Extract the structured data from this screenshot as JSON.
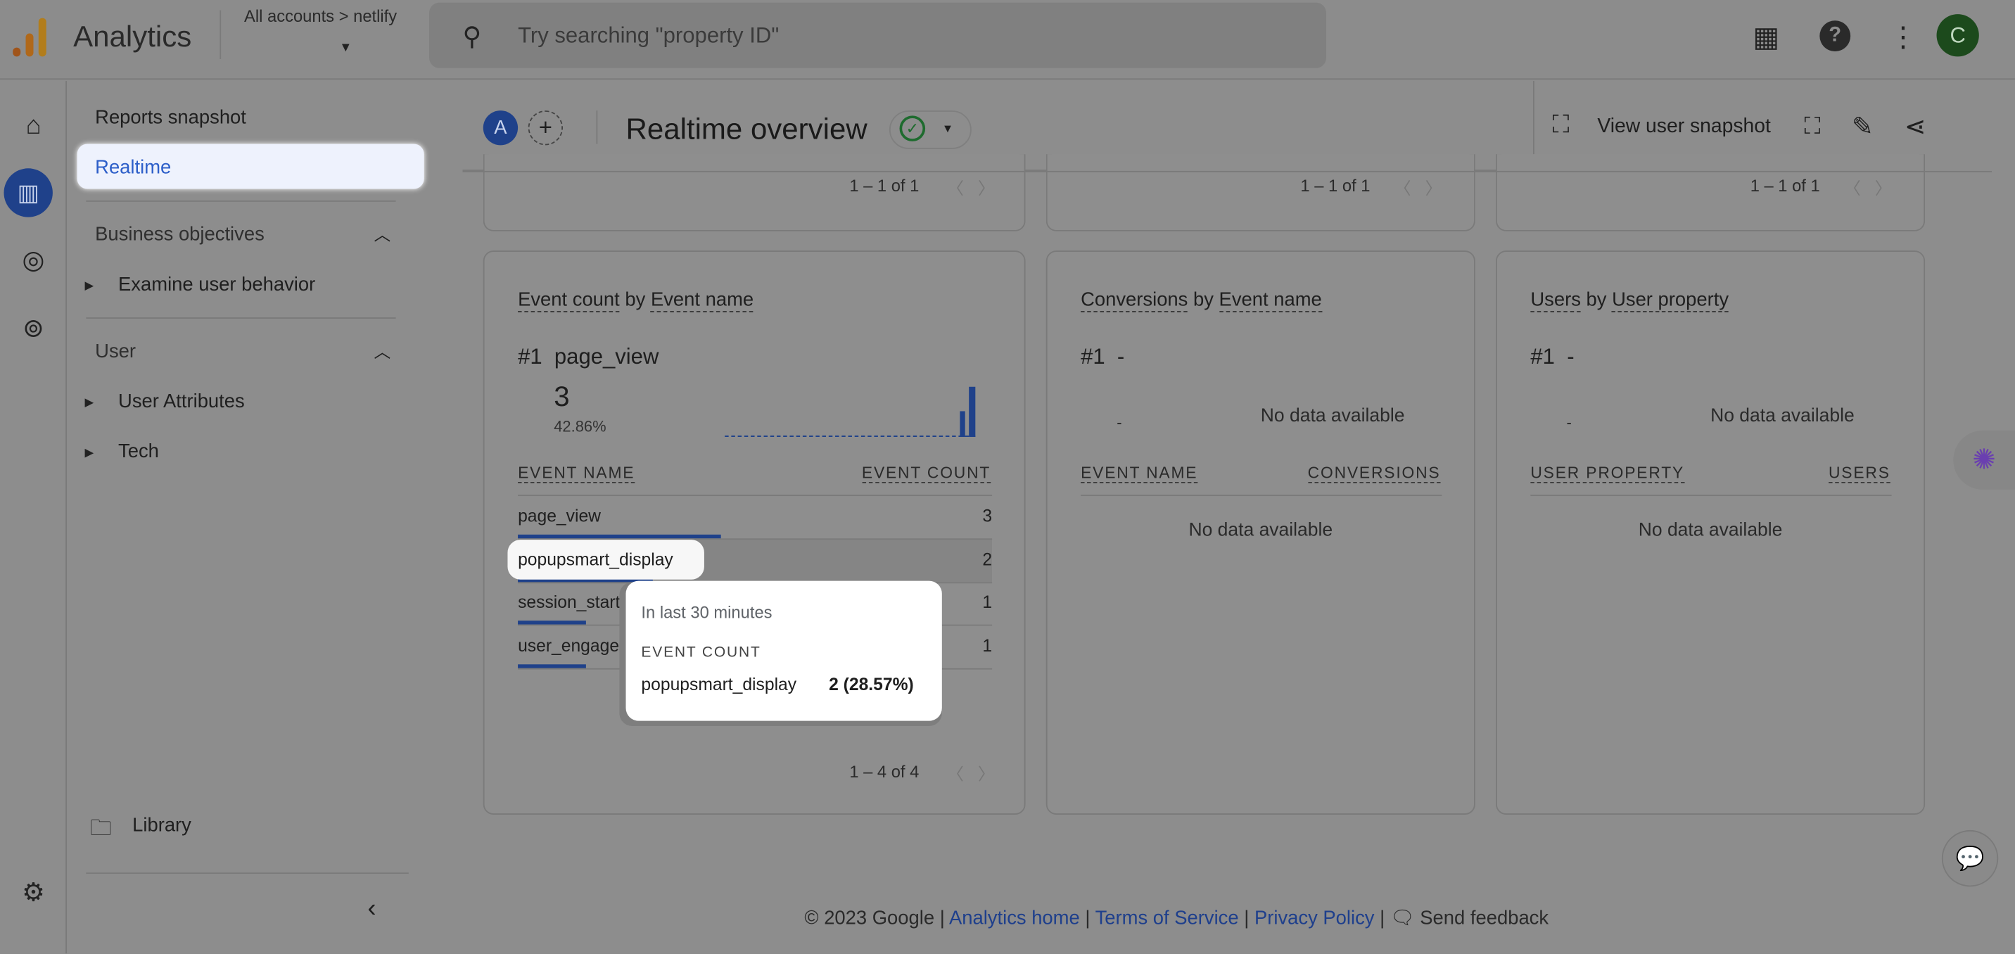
{
  "header": {
    "app_name": "Analytics",
    "breadcrumb": "All accounts > netlify",
    "search_placeholder": "Try searching \"property ID\"",
    "avatar_letter": "C"
  },
  "nav": {
    "reports_snapshot": "Reports snapshot",
    "realtime": "Realtime",
    "business_objectives": "Business objectives",
    "examine_user_behavior": "Examine user behavior",
    "user": "User",
    "user_attributes": "User Attributes",
    "tech": "Tech",
    "library": "Library"
  },
  "subheader": {
    "comparison_letter": "A",
    "title": "Realtime overview",
    "view_user_snapshot": "View user snapshot"
  },
  "top_pagers": [
    "1 – 1 of 1",
    "1 – 1 of 1",
    "1 – 1 of 1"
  ],
  "cards": {
    "event_count": {
      "title_metric": "Event count",
      "title_by": "by",
      "title_dim": "Event name",
      "rank": "#1",
      "top_name": "page_view",
      "top_value": "3",
      "top_pct": "42.86%",
      "col_name": "EVENT NAME",
      "col_value": "EVENT COUNT",
      "rows": [
        {
          "name": "page_view",
          "value": "3",
          "share": 0.4286
        },
        {
          "name": "popupsmart_display",
          "value": "2",
          "share": 0.2857
        },
        {
          "name": "session_start",
          "value": "1",
          "share": 0.1429
        },
        {
          "name": "user_engagement",
          "value": "1",
          "share": 0.1429
        }
      ],
      "pager": "1 – 4 of 4",
      "tooltip": {
        "period": "In last 30 minutes",
        "metric": "EVENT COUNT",
        "name": "popupsmart_display",
        "value": "2 (28.57%)"
      }
    },
    "conversions": {
      "title_metric": "Conversions",
      "title_by": "by",
      "title_dim": "Event name",
      "rank": "#1",
      "top_name": "-",
      "top_value": "-",
      "no_data": "No data available",
      "col_name": "EVENT NAME",
      "col_value": "CONVERSIONS",
      "table_no_data": "No data available"
    },
    "users": {
      "title_metric": "Users",
      "title_by": "by",
      "title_dim": "User property",
      "rank": "#1",
      "top_name": "-",
      "top_value": "-",
      "no_data": "No data available",
      "col_name": "USER PROPERTY",
      "col_value": "USERS",
      "table_no_data": "No data available"
    }
  },
  "footer": {
    "copyright": "© 2023 Google |",
    "analytics_home": "Analytics home",
    "terms": "Terms of Service",
    "privacy": "Privacy Policy",
    "sep": "|",
    "feedback": "Send feedback"
  },
  "colors": {
    "accent": "#1f418a",
    "highlight": "#eef2fd",
    "success": "#1e6b2e"
  }
}
